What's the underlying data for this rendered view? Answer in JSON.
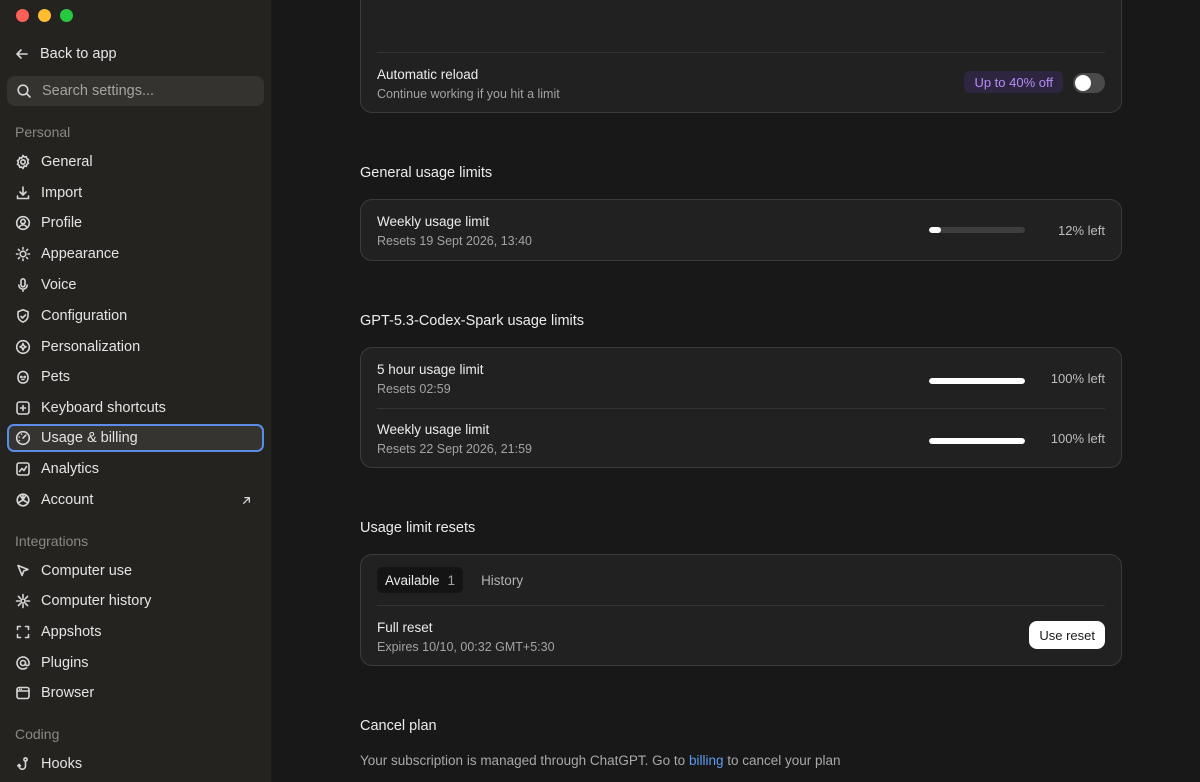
{
  "sidebar": {
    "back_label": "Back to app",
    "search_placeholder": "Search settings...",
    "sections": {
      "personal": "Personal",
      "integrations": "Integrations",
      "coding": "Coding"
    },
    "personal_items": [
      {
        "label": "General",
        "icon": "gear-icon"
      },
      {
        "label": "Import",
        "icon": "download-icon"
      },
      {
        "label": "Profile",
        "icon": "user-circle-icon"
      },
      {
        "label": "Appearance",
        "icon": "sun-icon"
      },
      {
        "label": "Voice",
        "icon": "microphone-icon"
      },
      {
        "label": "Configuration",
        "icon": "shield-icon"
      },
      {
        "label": "Personalization",
        "icon": "sparkle-circle-icon"
      },
      {
        "label": "Pets",
        "icon": "pet-icon"
      },
      {
        "label": "Keyboard shortcuts",
        "icon": "keyboard-icon"
      },
      {
        "label": "Usage & billing",
        "icon": "gauge-icon",
        "active": true
      },
      {
        "label": "Analytics",
        "icon": "chart-icon"
      },
      {
        "label": "Account",
        "icon": "openai-icon",
        "external": true
      }
    ],
    "integration_items": [
      {
        "label": "Computer use",
        "icon": "cursor-icon"
      },
      {
        "label": "Computer history",
        "icon": "burst-icon"
      },
      {
        "label": "Appshots",
        "icon": "frame-icon"
      },
      {
        "label": "Plugins",
        "icon": "at-icon"
      },
      {
        "label": "Browser",
        "icon": "browser-icon"
      }
    ],
    "coding_items": [
      {
        "label": "Hooks",
        "icon": "hook-icon"
      }
    ]
  },
  "main": {
    "auto_reload": {
      "title": "Automatic reload",
      "subtitle": "Continue working if you hit a limit",
      "badge": "Up to 40% off",
      "enabled": false
    },
    "general_limits": {
      "heading": "General usage limits",
      "rows": [
        {
          "title": "Weekly usage limit",
          "subtitle": "Resets 19 Sept 2026, 13:40",
          "left_text": "12% left",
          "fraction": 0.12
        }
      ]
    },
    "spark_limits": {
      "heading": "GPT-5.3-Codex-Spark usage limits",
      "rows": [
        {
          "title": "5 hour usage limit",
          "subtitle": "Resets 02:59",
          "left_text": "100% left",
          "fraction": 1.0
        },
        {
          "title": "Weekly usage limit",
          "subtitle": "Resets 22 Sept 2026, 21:59",
          "left_text": "100% left",
          "fraction": 1.0
        }
      ]
    },
    "resets": {
      "heading": "Usage limit resets",
      "tabs": [
        {
          "label": "Available",
          "count": "1",
          "active": true
        },
        {
          "label": "History",
          "count": "",
          "active": false
        }
      ],
      "item": {
        "title": "Full reset",
        "subtitle": "Expires 10/10, 00:32 GMT+5:30",
        "button": "Use reset"
      }
    },
    "cancel": {
      "heading": "Cancel plan",
      "text_before": "Your subscription is managed through ChatGPT. Go to ",
      "link": "billing",
      "text_after": " to cancel your plan"
    }
  }
}
